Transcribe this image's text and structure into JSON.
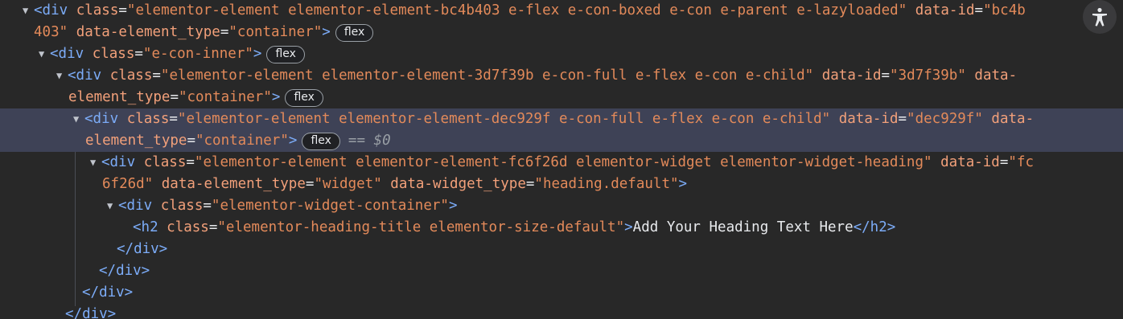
{
  "rows": [
    {
      "parts": [
        [
          "tag",
          "<div "
        ],
        [
          "attr",
          "class"
        ],
        [
          "eq",
          "="
        ],
        [
          "val",
          "\"elementor-element elementor-element-bc4b403 e-flex e-con-boxed e-con e-parent e-lazyloaded\""
        ],
        [
          "txt",
          " "
        ],
        [
          "attr",
          "data-id"
        ],
        [
          "eq",
          "="
        ],
        [
          "val",
          "\"bc4b"
        ]
      ]
    },
    {
      "parts": [
        [
          "val",
          "403\""
        ],
        [
          "txt",
          " "
        ],
        [
          "attr",
          "data-element_type"
        ],
        [
          "eq",
          "="
        ],
        [
          "val",
          "\"container\""
        ],
        [
          "tag",
          ">"
        ]
      ],
      "badge": "flex"
    },
    {
      "parts": [
        [
          "tag",
          "<div "
        ],
        [
          "attr",
          "class"
        ],
        [
          "eq",
          "="
        ],
        [
          "val",
          "\"e-con-inner\""
        ],
        [
          "tag",
          ">"
        ]
      ],
      "badge": "flex"
    },
    {
      "parts": [
        [
          "tag",
          "<div "
        ],
        [
          "attr",
          "class"
        ],
        [
          "eq",
          "="
        ],
        [
          "val",
          "\"elementor-element elementor-element-3d7f39b e-con-full e-flex e-con e-child\""
        ],
        [
          "txt",
          " "
        ],
        [
          "attr",
          "data-id"
        ],
        [
          "eq",
          "="
        ],
        [
          "val",
          "\"3d7f39b\""
        ],
        [
          "txt",
          " "
        ],
        [
          "attr",
          "data-"
        ]
      ]
    },
    {
      "parts": [
        [
          "attr",
          "element_type"
        ],
        [
          "eq",
          "="
        ],
        [
          "val",
          "\"container\""
        ],
        [
          "tag",
          ">"
        ]
      ],
      "badge": "flex"
    },
    {
      "parts": [
        [
          "tag",
          "<div "
        ],
        [
          "attr",
          "class"
        ],
        [
          "eq",
          "="
        ],
        [
          "val",
          "\"elementor-element elementor-element-dec929f e-con-full e-flex e-con e-child\""
        ],
        [
          "txt",
          " "
        ],
        [
          "attr",
          "data-id"
        ],
        [
          "eq",
          "="
        ],
        [
          "val",
          "\"dec929f\""
        ],
        [
          "txt",
          " "
        ],
        [
          "attr",
          "data-"
        ]
      ]
    },
    {
      "parts": [
        [
          "attr",
          "element_type"
        ],
        [
          "eq",
          "="
        ],
        [
          "val",
          "\"container\""
        ],
        [
          "tag",
          ">"
        ]
      ],
      "badge": "flex",
      "dollar": "== $0"
    },
    {
      "parts": [
        [
          "tag",
          "<div "
        ],
        [
          "attr",
          "class"
        ],
        [
          "eq",
          "="
        ],
        [
          "val",
          "\"elementor-element elementor-element-fc6f26d elementor-widget elementor-widget-heading\""
        ],
        [
          "txt",
          " "
        ],
        [
          "attr",
          "data-id"
        ],
        [
          "eq",
          "="
        ],
        [
          "val",
          "\"fc"
        ]
      ]
    },
    {
      "parts": [
        [
          "val",
          "6f26d\""
        ],
        [
          "txt",
          " "
        ],
        [
          "attr",
          "data-element_type"
        ],
        [
          "eq",
          "="
        ],
        [
          "val",
          "\"widget\""
        ],
        [
          "txt",
          " "
        ],
        [
          "attr",
          "data-widget_type"
        ],
        [
          "eq",
          "="
        ],
        [
          "val",
          "\"heading.default\""
        ],
        [
          "tag",
          ">"
        ]
      ]
    },
    {
      "parts": [
        [
          "tag",
          "<div "
        ],
        [
          "attr",
          "class"
        ],
        [
          "eq",
          "="
        ],
        [
          "val",
          "\"elementor-widget-container\""
        ],
        [
          "tag",
          ">"
        ]
      ]
    },
    {
      "parts": [
        [
          "tag",
          "<h2 "
        ],
        [
          "attr",
          "class"
        ],
        [
          "eq",
          "="
        ],
        [
          "val",
          "\"elementor-heading-title elementor-size-default\""
        ],
        [
          "tag",
          ">"
        ],
        [
          "txt",
          "Add Your Heading Text Here"
        ],
        [
          "tag",
          "</h2>"
        ]
      ]
    },
    {
      "parts": [
        [
          "tag",
          "</div>"
        ]
      ]
    },
    {
      "parts": [
        [
          "tag",
          "</div>"
        ]
      ]
    },
    {
      "parts": [
        [
          "tag",
          "</div>"
        ]
      ]
    },
    {
      "parts": [
        [
          "tag",
          "</div>"
        ]
      ]
    }
  ],
  "accessibility_icon": "accessibility-icon"
}
